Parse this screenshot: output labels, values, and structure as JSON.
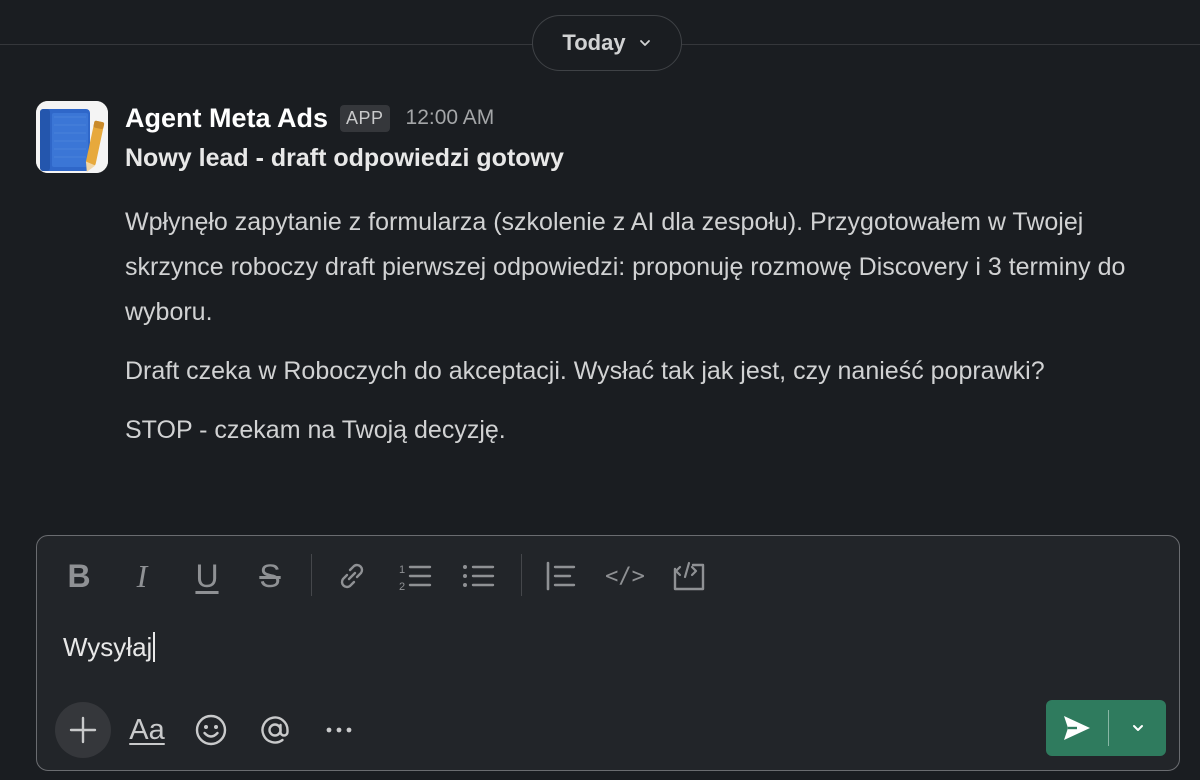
{
  "date_divider": {
    "label": "Today"
  },
  "message": {
    "sender": "Agent Meta Ads",
    "badge": "APP",
    "time": "12:00 AM",
    "subject": "Nowy lead - draft odpowiedzi gotowy",
    "paragraphs": [
      "Wpłynęło zapytanie z formularza (szkolenie z AI dla zespołu). Przygotowałem w Twojej skrzynce roboczy draft pierwszej odpowiedzi: proponuję rozmowę Discovery i 3 terminy do wyboru.",
      "Draft czeka w Roboczych do akceptacji. Wysłać tak jak jest, czy nanieść poprawki?",
      "STOP - czekam na Twoją decyzję."
    ]
  },
  "composer": {
    "value": "Wysyłaj",
    "toolbar": {
      "bold_glyph": "B",
      "italic_glyph": "I",
      "underline_glyph": "U",
      "strike_glyph": "S",
      "code_glyph": "</>"
    },
    "format_glyph": "Aa",
    "icons": {
      "bold": "bold-icon",
      "italic": "italic-icon",
      "underline": "underline-icon",
      "strikethrough": "strikethrough-icon",
      "link": "link-icon",
      "ordered_list": "ordered-list-icon",
      "bulleted_list": "bulleted-list-icon",
      "blockquote": "blockquote-icon",
      "code": "code-icon",
      "code_block": "code-block-icon",
      "plus": "plus-icon",
      "emoji": "emoji-icon",
      "mention": "at-icon",
      "more": "more-icon",
      "send": "send-icon",
      "send_options": "chevron-down-icon"
    }
  },
  "colors": {
    "background": "#1a1d21",
    "composer_background": "#222529",
    "send_button": "#2f7b5e",
    "text_primary": "#d1d2d3"
  }
}
